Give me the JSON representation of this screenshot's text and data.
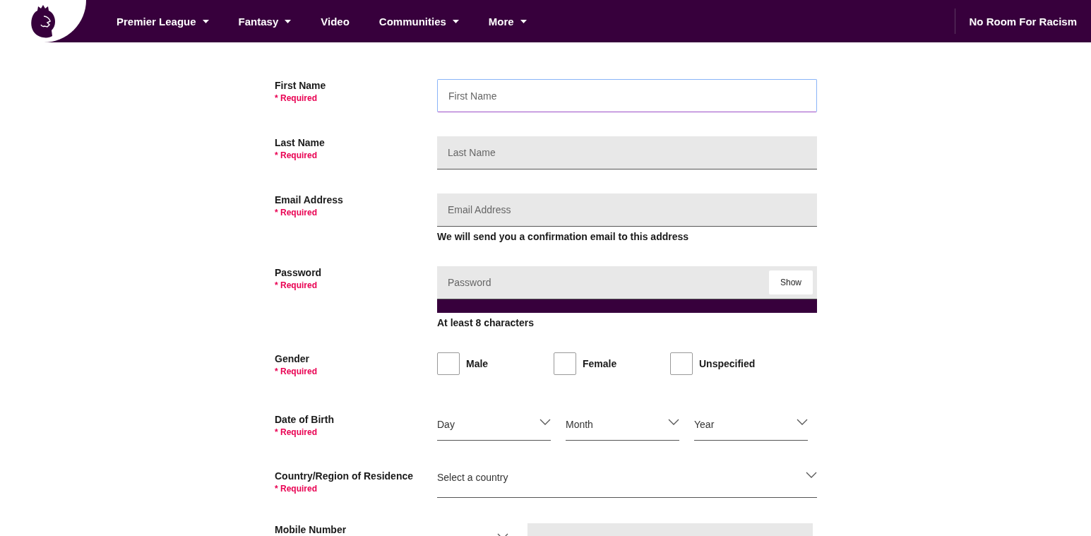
{
  "header": {
    "nav": [
      {
        "label": "Premier League",
        "dropdown": true
      },
      {
        "label": "Fantasy",
        "dropdown": true
      },
      {
        "label": "Video",
        "dropdown": false
      },
      {
        "label": "Communities",
        "dropdown": true
      },
      {
        "label": "More",
        "dropdown": true
      }
    ],
    "campaign_link": "No Room For Racism"
  },
  "form": {
    "fields": [
      {
        "kind": "text",
        "label": "First Name",
        "required": "* Required",
        "placeholder": "First Name",
        "focused": true
      },
      {
        "kind": "text",
        "label": "Last Name",
        "required": "* Required",
        "placeholder": "Last Name",
        "focused": false
      },
      {
        "kind": "text",
        "label": "Email Address",
        "required": "* Required",
        "placeholder": "Email Address",
        "focused": false,
        "note": "We will send you a confirmation email to this address"
      },
      {
        "kind": "password",
        "label": "Password",
        "required": "* Required",
        "placeholder": "Password",
        "show_button": "Show",
        "note": "At least 8 characters"
      },
      {
        "kind": "choice",
        "label": "Gender",
        "required": "* Required",
        "options": [
          {
            "label": "Male",
            "checked": false
          },
          {
            "label": "Female",
            "checked": false
          },
          {
            "label": "Unspecified",
            "checked": false
          }
        ]
      },
      {
        "kind": "selects",
        "label": "Date of Birth",
        "required": "* Required",
        "selects": [
          "Day",
          "Month",
          "Year"
        ]
      },
      {
        "kind": "select",
        "label": "Country/Region of Residence",
        "required": "* Required",
        "value": "Select a country"
      },
      {
        "kind": "mobile",
        "label": "Mobile Number"
      }
    ]
  }
}
